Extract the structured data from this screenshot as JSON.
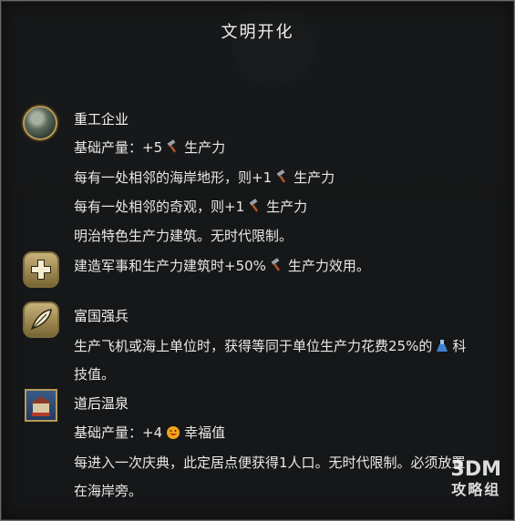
{
  "tooltip": {
    "title": "文明开化",
    "items": [
      {
        "name": "重工企业",
        "icon": "industrial-zone-icon",
        "lines": [
          {
            "pre": "基础产量：+5",
            "icon": "production-hammer-icon",
            "post": "生产力"
          },
          {
            "pre": "每有一处相邻的海岸地形，则+1",
            "icon": "production-hammer-icon",
            "post": "生产力"
          },
          {
            "pre": "每有一处相邻的奇观，则+1",
            "icon": "production-hammer-icon",
            "post": "生产力"
          },
          {
            "pre": "明治特色生产力建筑。无时代限制。"
          }
        ]
      },
      {
        "name": "",
        "icon": "plus-policy-icon",
        "lines": [
          {
            "pre": "建造军事和生产力建筑时+50%",
            "icon": "production-hammer-icon",
            "post": "生产力效用。"
          }
        ]
      },
      {
        "name": "富国强兵",
        "icon": "feather-policy-icon",
        "lines": [
          {
            "pre": "生产飞机或海上单位时，获得等同于单位生产力花费25%的",
            "icon": "science-flask-icon",
            "post": "科"
          },
          {
            "pre": "技值。"
          }
        ]
      },
      {
        "name": "道后温泉",
        "icon": "onsen-building-icon",
        "lines": [
          {
            "pre": "基础产量：+4",
            "icon": "amenity-smile-icon",
            "post": "幸福值"
          },
          {
            "pre": "每进入一次庆典，此定居点便获得1人口。无时代限制。必须放置"
          },
          {
            "pre": "在海岸旁。"
          }
        ]
      }
    ]
  },
  "watermark": {
    "main": "3DM",
    "sub": "攻略组"
  },
  "colors": {
    "border_gold": "#b69a5a",
    "panel_bg": "#161718",
    "text": "#e8e8e8"
  }
}
